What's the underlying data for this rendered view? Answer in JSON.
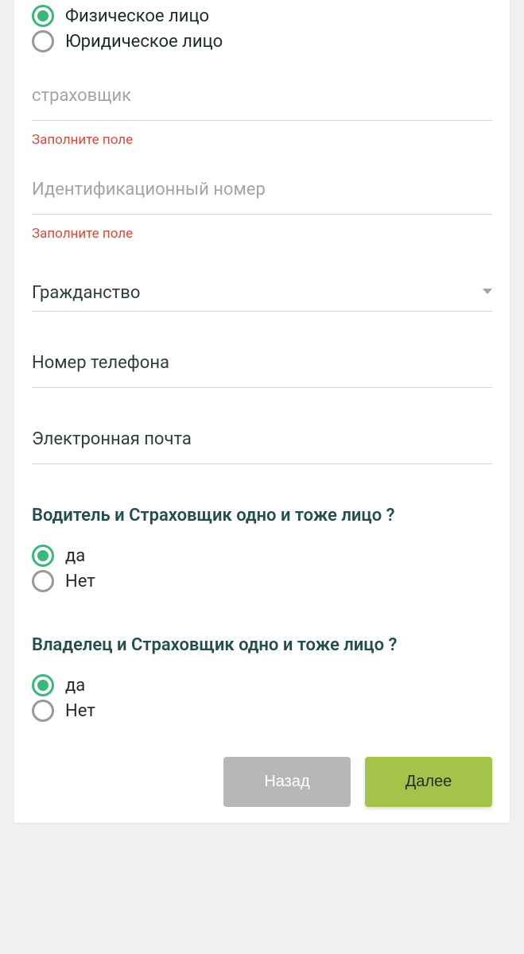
{
  "entity_type": {
    "options": [
      {
        "label": "Физическое лицо",
        "selected": true
      },
      {
        "label": "Юридическое лицо",
        "selected": false
      }
    ]
  },
  "fields": {
    "insurer": {
      "label": "страховщик",
      "error": "Заполните поле"
    },
    "id_number": {
      "label": "Идентификационный номер",
      "error": "Заполните поле"
    },
    "citizenship": {
      "label": "Гражданство"
    },
    "phone": {
      "label": "Номер телефона"
    },
    "email": {
      "label": "Электронная почта"
    }
  },
  "questions": {
    "driver_insurer_same": {
      "text": "Водитель и Страховщик одно и тоже лицо ?",
      "options": [
        {
          "label": "да",
          "selected": true
        },
        {
          "label": "Нет",
          "selected": false
        }
      ]
    },
    "owner_insurer_same": {
      "text": "Владелец и Страховщик одно и тоже лицо ?",
      "options": [
        {
          "label": "да",
          "selected": true
        },
        {
          "label": "Нет",
          "selected": false
        }
      ]
    }
  },
  "buttons": {
    "back": "Назад",
    "next": "Далее"
  }
}
